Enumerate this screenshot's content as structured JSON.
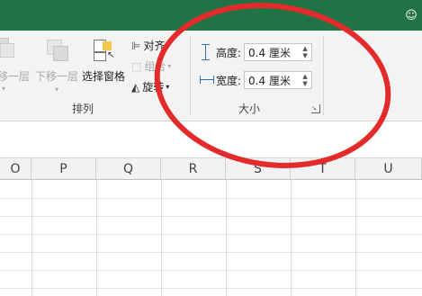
{
  "ribbon": {
    "arrange_group": {
      "label": "排列",
      "send_backward": "移一层",
      "send_backward_sub": "▾",
      "bring_down": "下移一层",
      "selection_pane": "选择窗格",
      "align": "对齐",
      "group": "组合",
      "rotate": "旋转"
    },
    "size_group": {
      "label": "大小",
      "height_label": "高度:",
      "height_value": "0.4 厘米",
      "width_label": "宽度:",
      "width_value": "0.4 厘米"
    }
  },
  "columns": [
    "O",
    "P",
    "Q",
    "R",
    "S",
    "T",
    "U"
  ],
  "colors": {
    "titlebar": "#217346",
    "annotation": "#e32b2b"
  }
}
